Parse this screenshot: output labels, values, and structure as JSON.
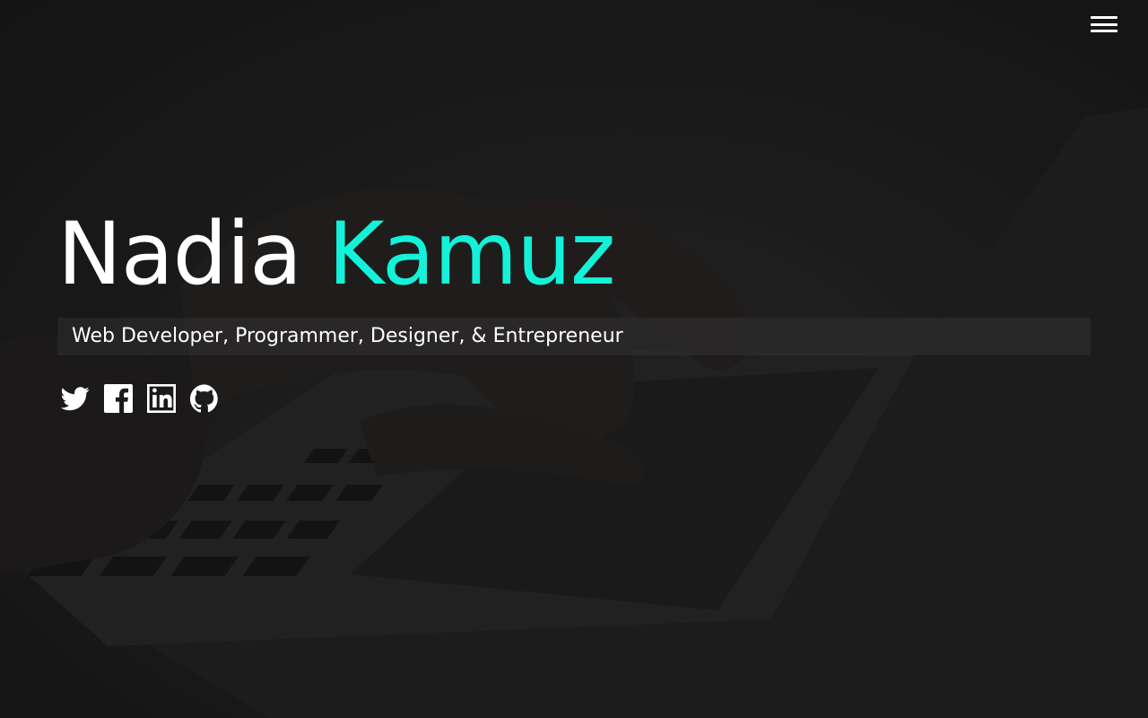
{
  "header": {
    "menu_icon": "hamburger-menu-icon"
  },
  "hero": {
    "first_name": "Nadia",
    "last_name": "Kamuz",
    "tagline": "Web Developer, Programmer, Designer, & Entrepreneur",
    "accent_color": "#14f1d9",
    "text_color": "#ffffff",
    "background_color": "#1c1c1c"
  },
  "socials": [
    {
      "name": "Twitter",
      "icon": "twitter-icon"
    },
    {
      "name": "Facebook",
      "icon": "facebook-icon"
    },
    {
      "name": "LinkedIn",
      "icon": "linkedin-icon"
    },
    {
      "name": "GitHub",
      "icon": "github-icon"
    }
  ]
}
